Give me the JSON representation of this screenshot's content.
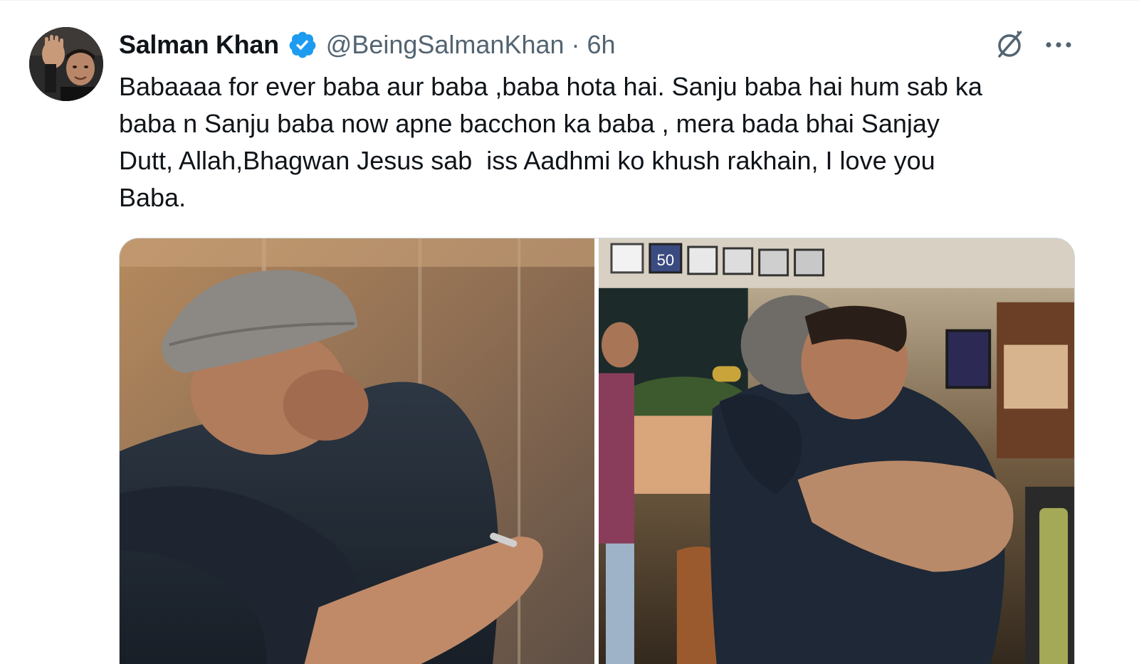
{
  "tweet": {
    "author_name": "Salman Khan",
    "handle": "@BeingSalmanKhan",
    "separator": "·",
    "time": "6h",
    "text": "Babaaaa for ever baba aur baba ,baba hota hai. Sanju baba hai hum sab ka\nbaba n Sanju baba now apne bacchon ka baba , mera bada bhai Sanjay\nDutt, Allah,Bhagwan Jesus sab  iss Aadhmi ko khush rakhain, I love you\nBaba.",
    "verified_color": "#1d9bf0"
  },
  "icons": {
    "avatar": "profile-photo",
    "verified": "verified-badge-icon",
    "grok": "grok-icon",
    "more": "more-options-icon"
  },
  "media": {
    "count": 2,
    "photos": [
      {
        "subject": "photo-hug-elevator"
      },
      {
        "subject": "photo-hug-studio",
        "frame_label": "50"
      }
    ]
  }
}
